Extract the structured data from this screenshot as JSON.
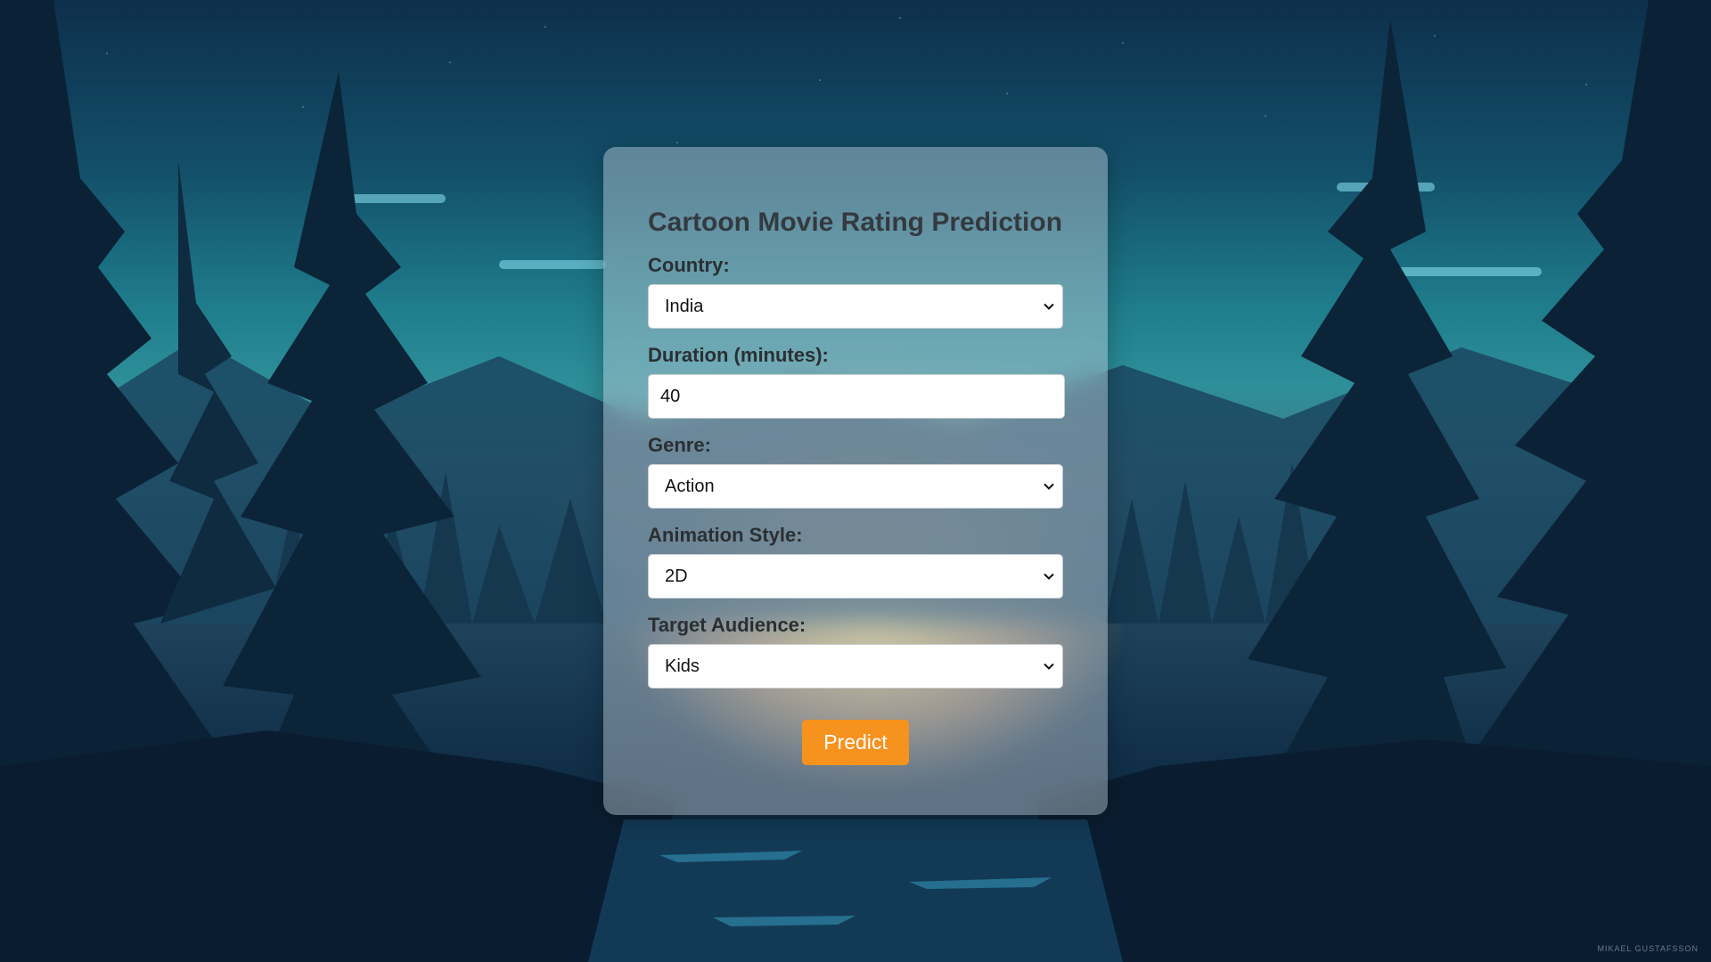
{
  "form": {
    "title": "Cartoon Movie Rating Prediction",
    "fields": [
      {
        "label": "Country:",
        "value": "India",
        "type": "select"
      },
      {
        "label": "Duration (minutes):",
        "value": "40",
        "type": "number"
      },
      {
        "label": "Genre:",
        "value": "Action",
        "type": "select"
      },
      {
        "label": "Animation Style:",
        "value": "2D",
        "type": "select"
      },
      {
        "label": "Target Audience:",
        "value": "Kids",
        "type": "select"
      }
    ],
    "submit_label": "Predict"
  },
  "background": {
    "credit": "MIKAEL GUSTAFSSON"
  },
  "colors": {
    "accent": "#f6921e",
    "title": "#333a40"
  }
}
